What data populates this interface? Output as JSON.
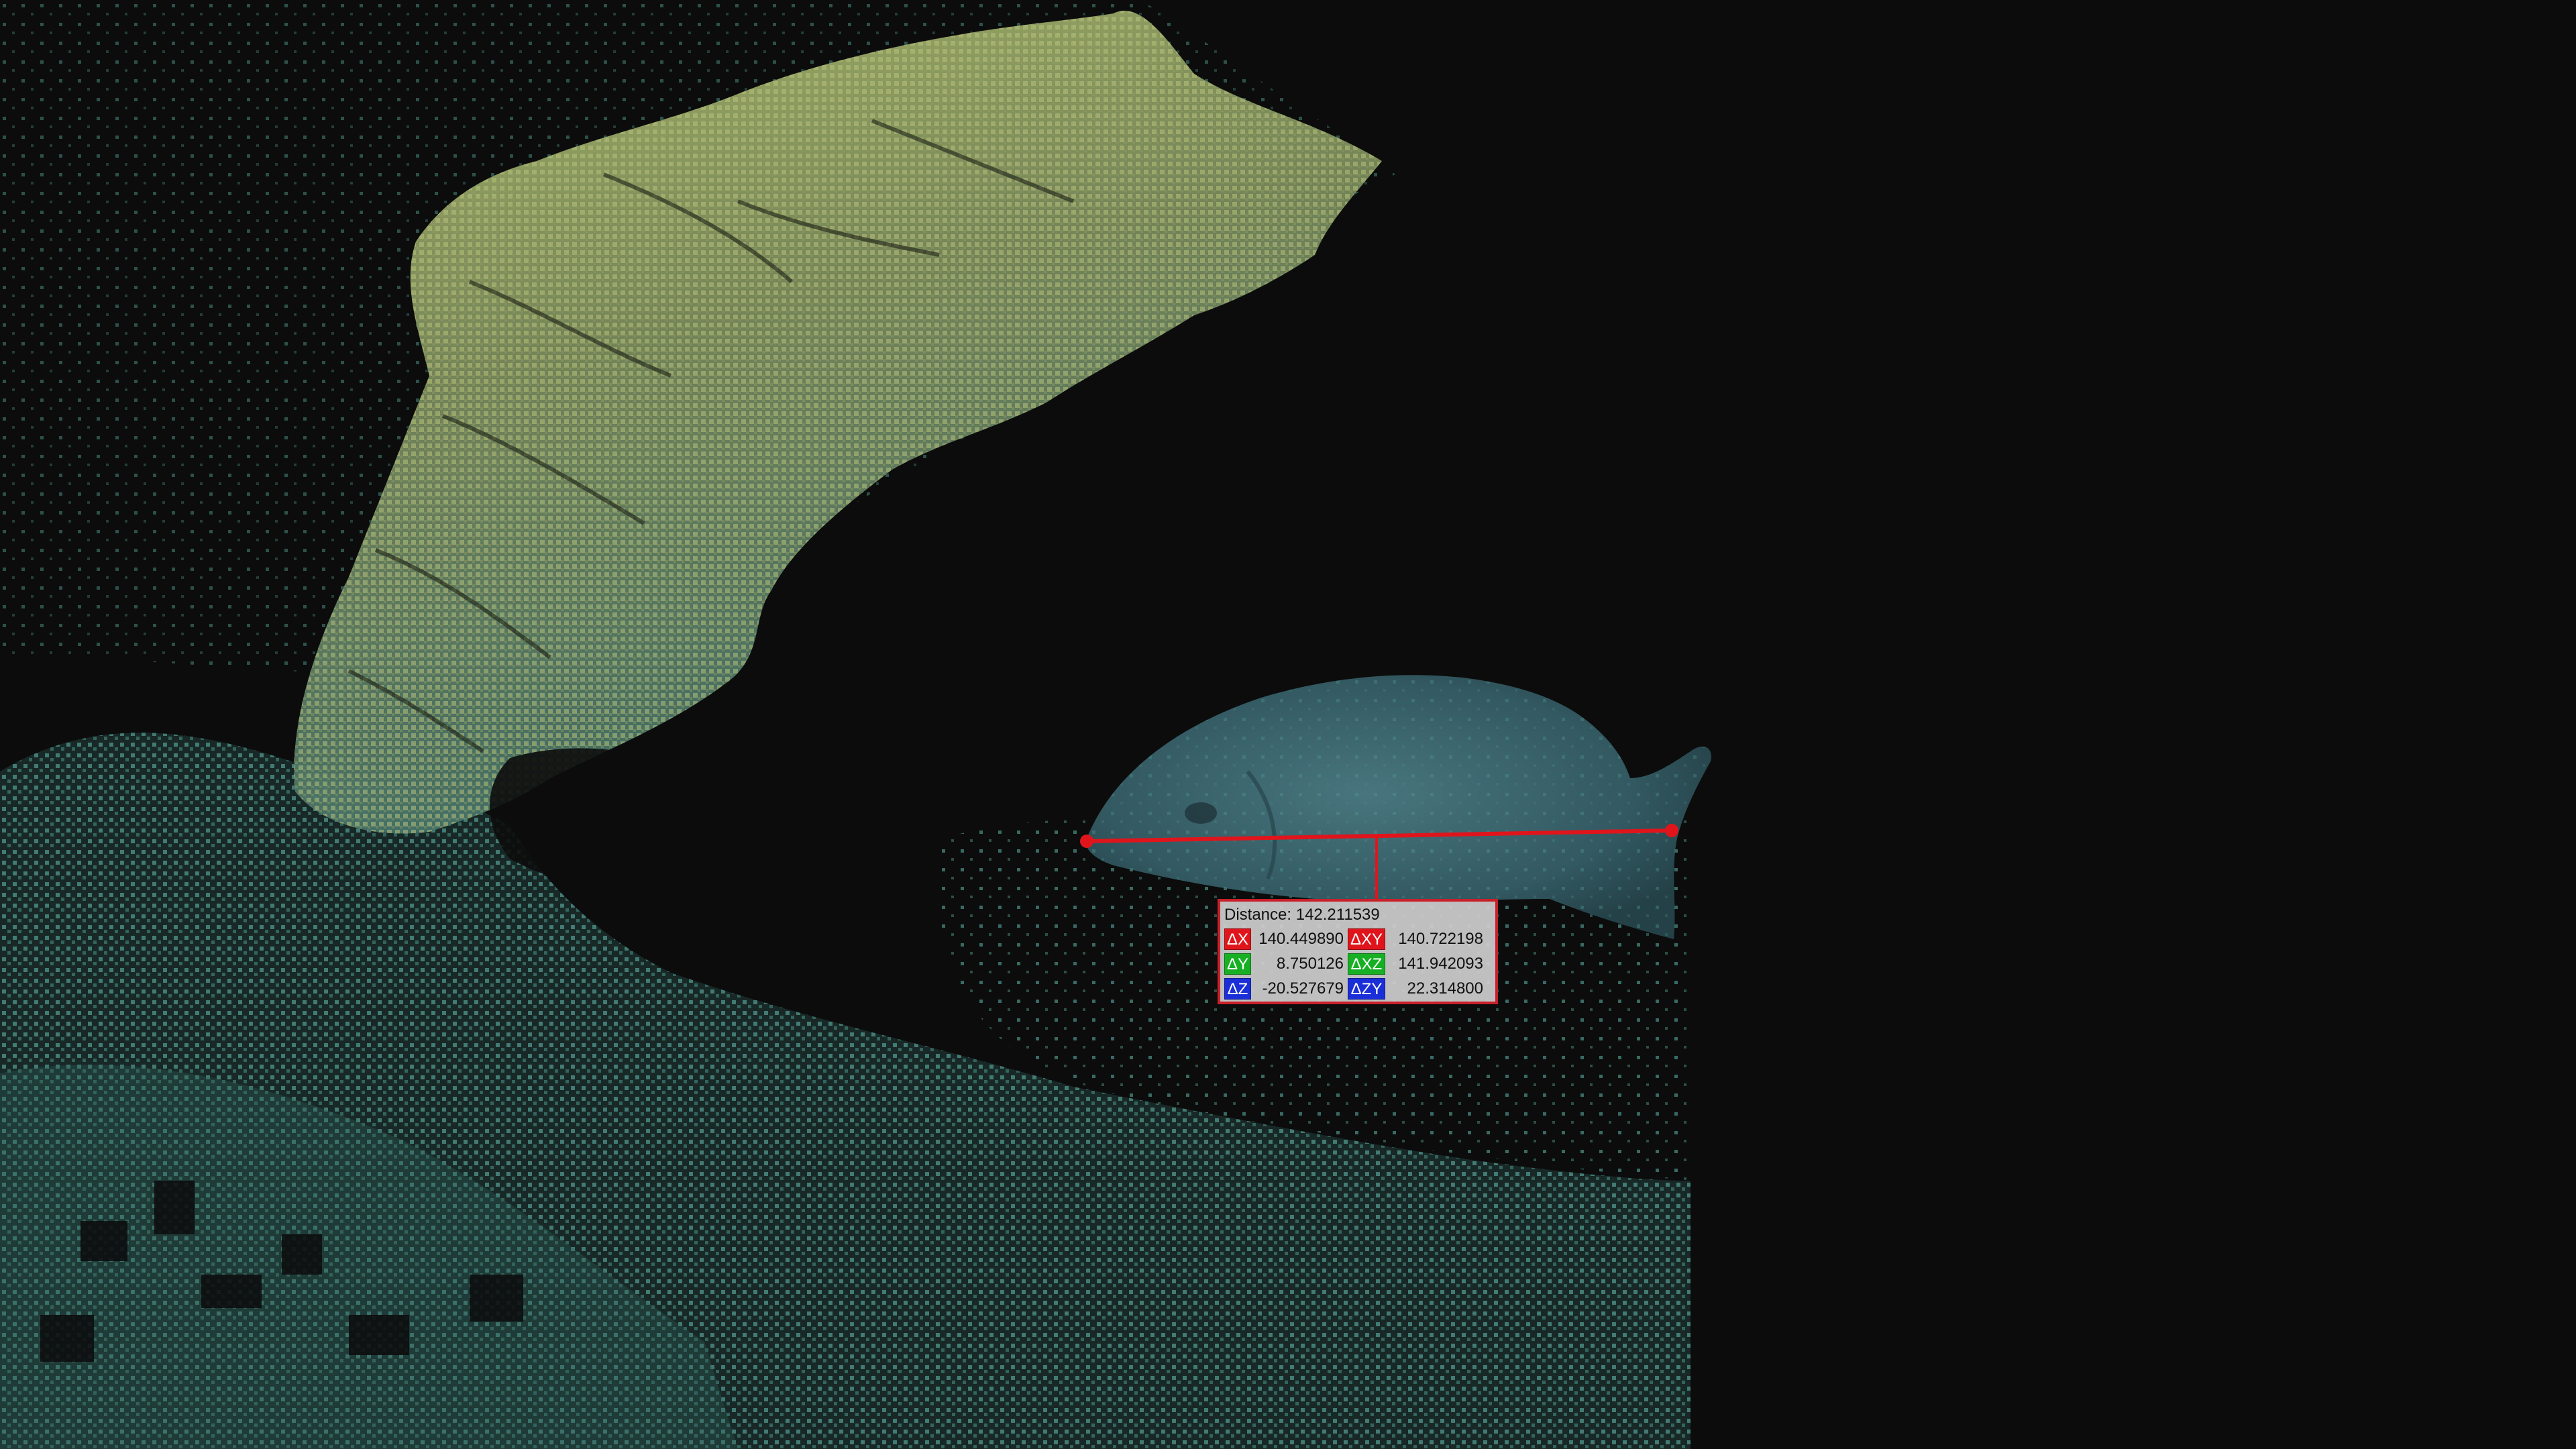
{
  "measurement": {
    "distance_label": "Distance:",
    "distance_value": "142.211539",
    "rows": [
      {
        "a_tag": "ΔX",
        "a_value": "140.449890",
        "b_tag": "ΔXY",
        "b_value": "140.722198"
      },
      {
        "a_tag": "ΔY",
        "a_value": "8.750126",
        "b_tag": "ΔXZ",
        "b_value": "141.942093"
      },
      {
        "a_tag": "ΔZ",
        "a_value": "-20.527679",
        "b_tag": "ΔZY",
        "b_value": "22.314800"
      }
    ]
  },
  "colors": {
    "background": "#0c0c0c",
    "measure_line": "#e0151c",
    "x_axis": "#e0151c",
    "y_axis": "#17b024",
    "z_axis": "#1b2fd8",
    "point_cloud_teal": "#4e9e95",
    "point_cloud_yellow": "#a9b86a",
    "fish": "#3f6a73"
  }
}
